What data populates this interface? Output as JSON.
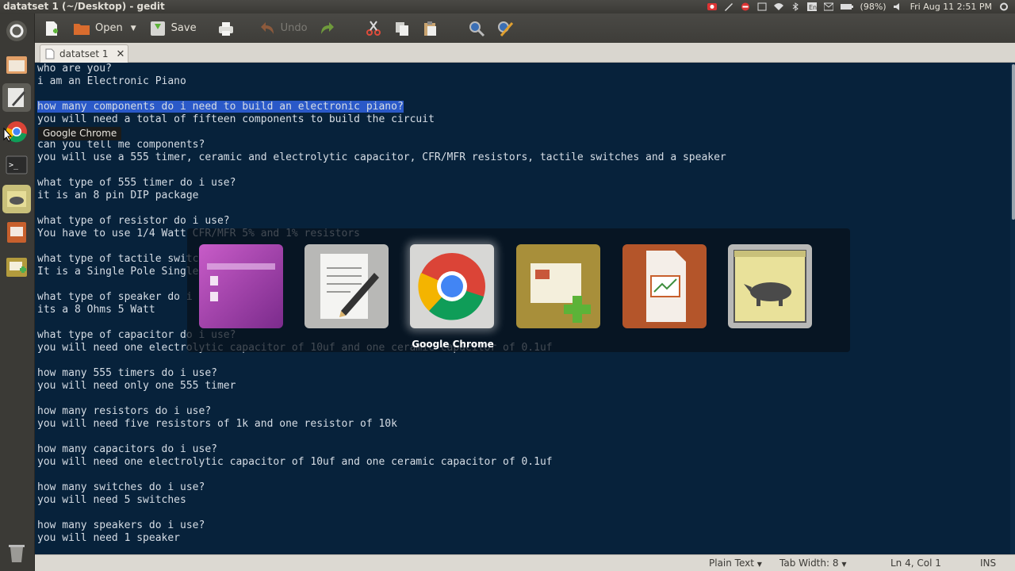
{
  "window_title": "datatset 1 (~/Desktop) - gedit",
  "indicators": {
    "battery": "(98%)",
    "clock": "Fri Aug 11  2:51 PM"
  },
  "launcher": {
    "items": [
      "dash-home",
      "files",
      "text-editor",
      "google-chrome",
      "terminal",
      "rhino-app",
      "impress",
      "presentation-add"
    ],
    "tooltip": "Google Chrome"
  },
  "toolbar": {
    "open_label": "Open",
    "save_label": "Save",
    "undo_label": "Undo"
  },
  "tab": {
    "title": "datatset 1",
    "close": "✕"
  },
  "editor": {
    "lines": [
      "who are you?",
      "i am an Electronic Piano",
      "",
      "how many components do i need to build an electronic piano?",
      "you will need a total of fifteen components to build the circuit",
      "",
      "can you tell me components?",
      "you will use a 555 timer, ceramic and electrolytic capacitor, CFR/MFR resistors, tactile switches and a speaker",
      "",
      "what type of 555 timer do i use?",
      "it is an 8 pin DIP package",
      "",
      "what type of resistor do i use?",
      "You have to use 1/4 Watt CFR/MFR 5% and 1% resistors",
      "",
      "what type of tactile switch do i use?",
      "It is a Single Pole Single Throw switch",
      "",
      "what type of speaker do i use?",
      "its a 8 Ohms 5 Watt",
      "",
      "what type of capacitor do i use?",
      "you will need one electrolytic capacitor of 10uf and one ceramic capacitor of 0.1uf",
      "",
      "how many 555 timers do i use?",
      "you will need only one 555 timer",
      "",
      "how many resistors do i use?",
      "you will need five resistors of 1k and one resistor of 10k",
      "",
      "how many capacitors do i use?",
      "you will need one electrolytic capacitor of 10uf and one ceramic capacitor of 0.1uf",
      "",
      "how many switches do i use?",
      "you will need 5 switches",
      "",
      "how many speakers do i use?",
      "you will need 1 speaker"
    ],
    "selected_line": 3
  },
  "statusbar": {
    "language": "Plain Text",
    "tab_width": "Tab Width: 8",
    "position": "Ln 4, Col 1",
    "mode": "INS"
  },
  "switcher": {
    "apps": [
      "purple-app",
      "text-editor",
      "google-chrome",
      "presentation-add",
      "impress",
      "rhino-app"
    ],
    "active": "google-chrome",
    "label": "Google Chrome"
  }
}
